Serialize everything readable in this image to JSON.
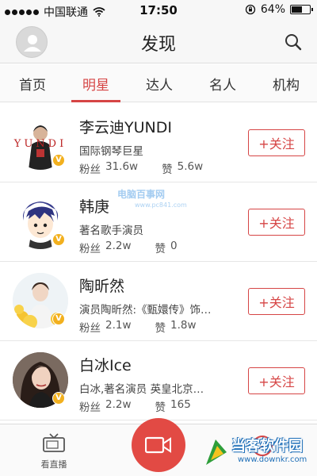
{
  "status_bar": {
    "carrier": "中国联通",
    "time": "17:50",
    "battery": "64%",
    "battery_level": 0.64
  },
  "header": {
    "title": "发现"
  },
  "tabs": [
    {
      "label": "首页"
    },
    {
      "label": "明星",
      "active": true
    },
    {
      "label": "达人"
    },
    {
      "label": "名人"
    },
    {
      "label": "机构"
    }
  ],
  "list": [
    {
      "name": "李云迪YUNDI",
      "desc": "国际钢琴巨星",
      "fans_label": "粉丝",
      "fans": "31.6w",
      "likes_label": "赞",
      "likes": "5.6w",
      "follow": "+关注",
      "avatar_text": "YUNDI"
    },
    {
      "name": "韩庚",
      "desc": "著名歌手演员",
      "fans_label": "粉丝",
      "fans": "2.2w",
      "likes_label": "赞",
      "likes": "0",
      "follow": "+关注"
    },
    {
      "name": "陶昕然",
      "desc": "演员陶昕然:《甄嬛传》饰…",
      "fans_label": "粉丝",
      "fans": "2.1w",
      "likes_label": "赞",
      "likes": "1.8w",
      "follow": "+关注"
    },
    {
      "name": "白冰Ice",
      "desc": "白冰,著名演员 英皇北京…",
      "fans_label": "粉丝",
      "fans": "2.2w",
      "likes_label": "赞",
      "likes": "165",
      "follow": "+关注"
    }
  ],
  "bottom_bar": {
    "live_label": "看直播"
  },
  "watermarks": {
    "center_cn": "电脑百事网",
    "center_url": "www.pc841.com",
    "corner_cn": "当客软件园",
    "corner_url": "www.downkr.com"
  },
  "colors": {
    "accent": "#d64545",
    "badge": "#f2b01e",
    "camera": "#e24a44"
  }
}
